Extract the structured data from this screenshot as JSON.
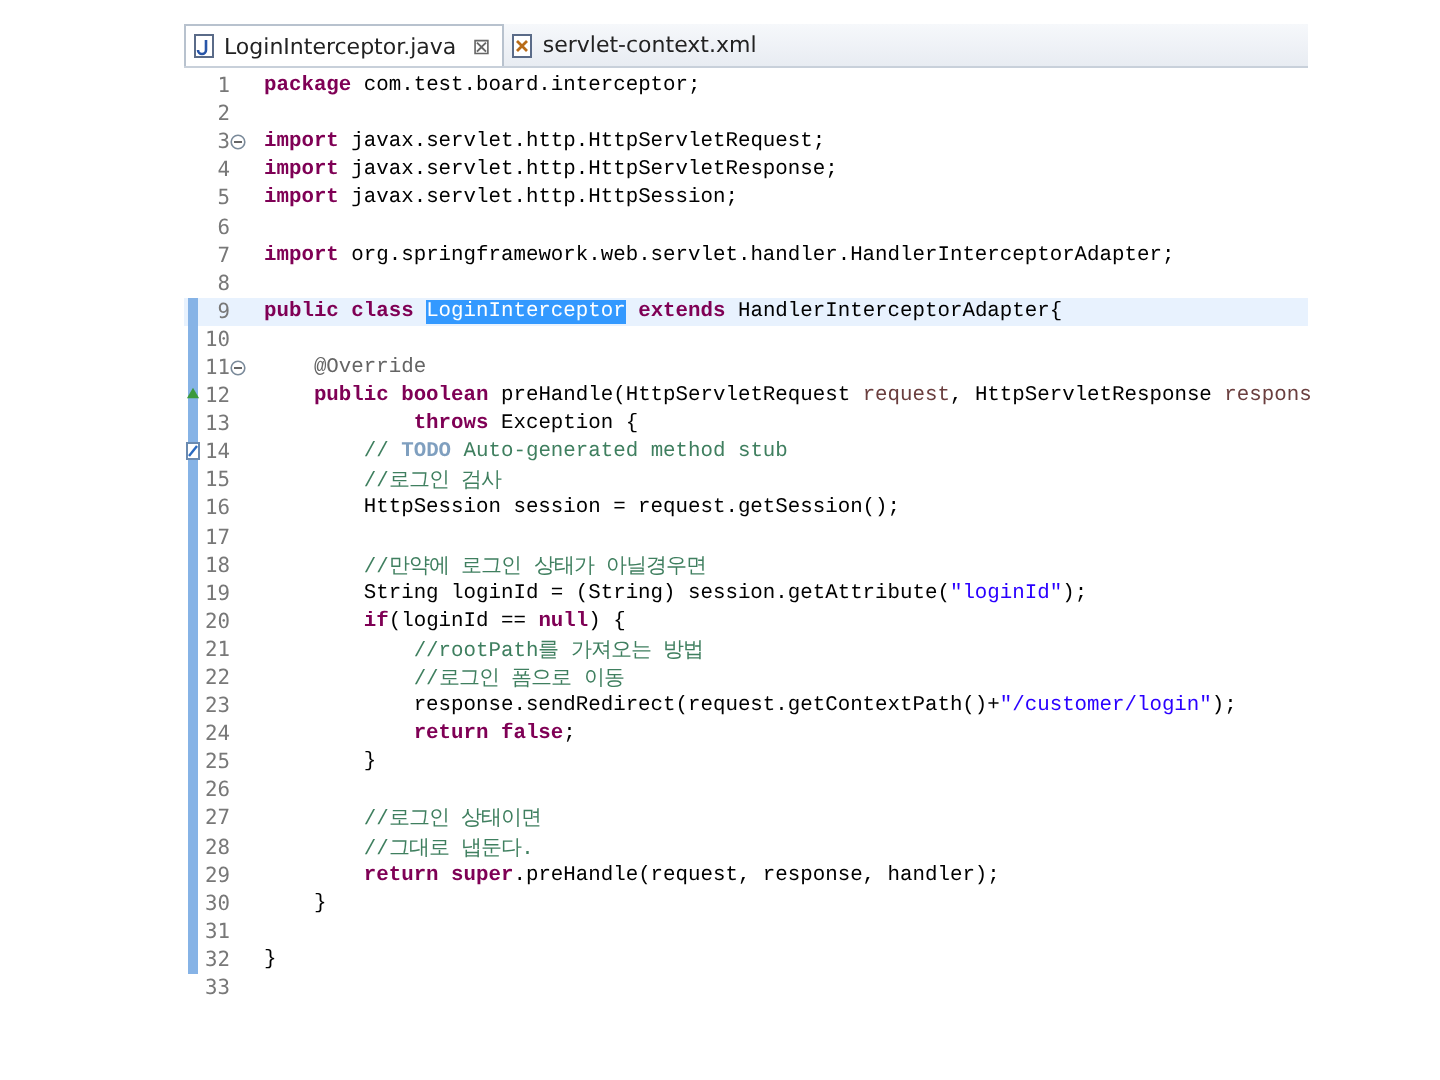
{
  "tabs": [
    {
      "label": "LoginInterceptor.java",
      "kind": "java",
      "selected": true,
      "close": "⊠"
    },
    {
      "label": "servlet-context.xml",
      "kind": "xml",
      "selected": false
    }
  ],
  "lines": [
    {
      "number": "1",
      "current": false,
      "changed": false,
      "segments": [
        {
          "kind": "keyword",
          "text": "package"
        },
        {
          "kind": "plain",
          "text": " com.test.board.interceptor;"
        }
      ]
    },
    {
      "number": "2",
      "current": false,
      "changed": false
    },
    {
      "number": "3",
      "current": false,
      "changed": false,
      "kind": "fold",
      "segments": [
        {
          "kind": "keyword",
          "text": "import"
        },
        {
          "kind": "plain",
          "text": " javax.servlet.http.HttpServletRequest;"
        }
      ]
    },
    {
      "number": "4",
      "current": false,
      "changed": false,
      "segments": [
        {
          "kind": "keyword",
          "text": "import"
        },
        {
          "kind": "plain",
          "text": " javax.servlet.http.HttpServletResponse;"
        }
      ]
    },
    {
      "number": "5",
      "current": false,
      "changed": false,
      "segments": [
        {
          "kind": "keyword",
          "text": "import"
        },
        {
          "kind": "plain",
          "text": " javax.servlet.http.HttpSession;"
        }
      ]
    },
    {
      "number": "6",
      "current": false,
      "changed": false
    },
    {
      "number": "7",
      "current": false,
      "changed": false,
      "segments": [
        {
          "kind": "keyword",
          "text": "import"
        },
        {
          "kind": "plain",
          "text": " org.springframework.web.servlet.handler.HandlerInterceptorAdapter;"
        }
      ]
    },
    {
      "number": "8",
      "current": false,
      "changed": false
    },
    {
      "number": "9",
      "current": true,
      "changed": true,
      "segments": [
        {
          "kind": "keyword",
          "text": "public class "
        },
        {
          "kind": "selection",
          "text": "LoginInterceptor"
        },
        {
          "kind": "keyword",
          "text": " extends"
        },
        {
          "kind": "plain",
          "text": " HandlerInterceptorAdapter{"
        }
      ]
    },
    {
      "number": "10",
      "current": false,
      "changed": true
    },
    {
      "number": "11",
      "current": false,
      "changed": true,
      "kind": "fold",
      "segments": [
        {
          "kind": "annotation",
          "text": "    @Override"
        }
      ]
    },
    {
      "number": "12",
      "current": false,
      "changed": true,
      "kind": "override",
      "segments": [
        {
          "kind": "keyword",
          "text": "    public boolean"
        },
        {
          "kind": "plain",
          "text": " preHandle(HttpServletRequest "
        },
        {
          "kind": "param",
          "text": "request"
        },
        {
          "kind": "plain",
          "text": ", HttpServletResponse "
        },
        {
          "kind": "param",
          "text": "respons"
        }
      ]
    },
    {
      "number": "13",
      "current": false,
      "changed": true,
      "segments": [
        {
          "kind": "keyword",
          "text": "            throws"
        },
        {
          "kind": "plain",
          "text": " Exception {"
        }
      ]
    },
    {
      "number": "14",
      "current": false,
      "changed": true,
      "kind": "task",
      "segments": [
        {
          "kind": "comment",
          "text": "        // "
        },
        {
          "kind": "todo",
          "text": "TODO"
        },
        {
          "kind": "comment",
          "text": " Auto-generated method stub"
        }
      ]
    },
    {
      "number": "15",
      "current": false,
      "changed": true,
      "segments": [
        {
          "kind": "comment",
          "text": "        //로그인 검사"
        }
      ]
    },
    {
      "number": "16",
      "current": false,
      "changed": true,
      "segments": [
        {
          "kind": "plain",
          "text": "        HttpSession session = request.getSession();"
        }
      ]
    },
    {
      "number": "17",
      "current": false,
      "changed": true
    },
    {
      "number": "18",
      "current": false,
      "changed": true,
      "segments": [
        {
          "kind": "comment",
          "text": "        //만약에 로그인 상태가 아닐경우면"
        }
      ]
    },
    {
      "number": "19",
      "current": false,
      "changed": true,
      "segments": [
        {
          "kind": "plain",
          "text": "        String loginId = (String) session.getAttribute("
        },
        {
          "kind": "string",
          "text": "\"loginId\""
        },
        {
          "kind": "plain",
          "text": ");"
        }
      ]
    },
    {
      "number": "20",
      "current": false,
      "changed": true,
      "segments": [
        {
          "kind": "keyword",
          "text": "        if"
        },
        {
          "kind": "plain",
          "text": "(loginId == "
        },
        {
          "kind": "keyword",
          "text": "null"
        },
        {
          "kind": "plain",
          "text": ") {"
        }
      ]
    },
    {
      "number": "21",
      "current": false,
      "changed": true,
      "segments": [
        {
          "kind": "comment",
          "text": "            //rootPath를 가져오는 방법"
        }
      ]
    },
    {
      "number": "22",
      "current": false,
      "changed": true,
      "segments": [
        {
          "kind": "comment",
          "text": "            //로그인 폼으로 이동"
        }
      ]
    },
    {
      "number": "23",
      "current": false,
      "changed": true,
      "segments": [
        {
          "kind": "plain",
          "text": "            response.sendRedirect(request.getContextPath()+"
        },
        {
          "kind": "string",
          "text": "\"/customer/login\""
        },
        {
          "kind": "plain",
          "text": ");"
        }
      ]
    },
    {
      "number": "24",
      "current": false,
      "changed": true,
      "segments": [
        {
          "kind": "keyword",
          "text": "            return false"
        },
        {
          "kind": "plain",
          "text": ";"
        }
      ]
    },
    {
      "number": "25",
      "current": false,
      "changed": true,
      "segments": [
        {
          "kind": "plain",
          "text": "        }"
        }
      ]
    },
    {
      "number": "26",
      "current": false,
      "changed": true
    },
    {
      "number": "27",
      "current": false,
      "changed": true,
      "segments": [
        {
          "kind": "comment",
          "text": "        //로그인 상태이면"
        }
      ]
    },
    {
      "number": "28",
      "current": false,
      "changed": true,
      "segments": [
        {
          "kind": "comment",
          "text": "        //그대로 냅둔다."
        }
      ]
    },
    {
      "number": "29",
      "current": false,
      "changed": true,
      "segments": [
        {
          "kind": "keyword",
          "text": "        return super"
        },
        {
          "kind": "plain",
          "text": ".preHandle(request, response, handler);"
        }
      ]
    },
    {
      "number": "30",
      "current": false,
      "changed": true,
      "segments": [
        {
          "kind": "plain",
          "text": "    }"
        }
      ]
    },
    {
      "number": "31",
      "current": false,
      "changed": true
    },
    {
      "number": "32",
      "current": false,
      "changed": true,
      "segments": [
        {
          "kind": "plain",
          "text": "}"
        }
      ]
    },
    {
      "number": "33",
      "current": false,
      "changed": false
    }
  ]
}
